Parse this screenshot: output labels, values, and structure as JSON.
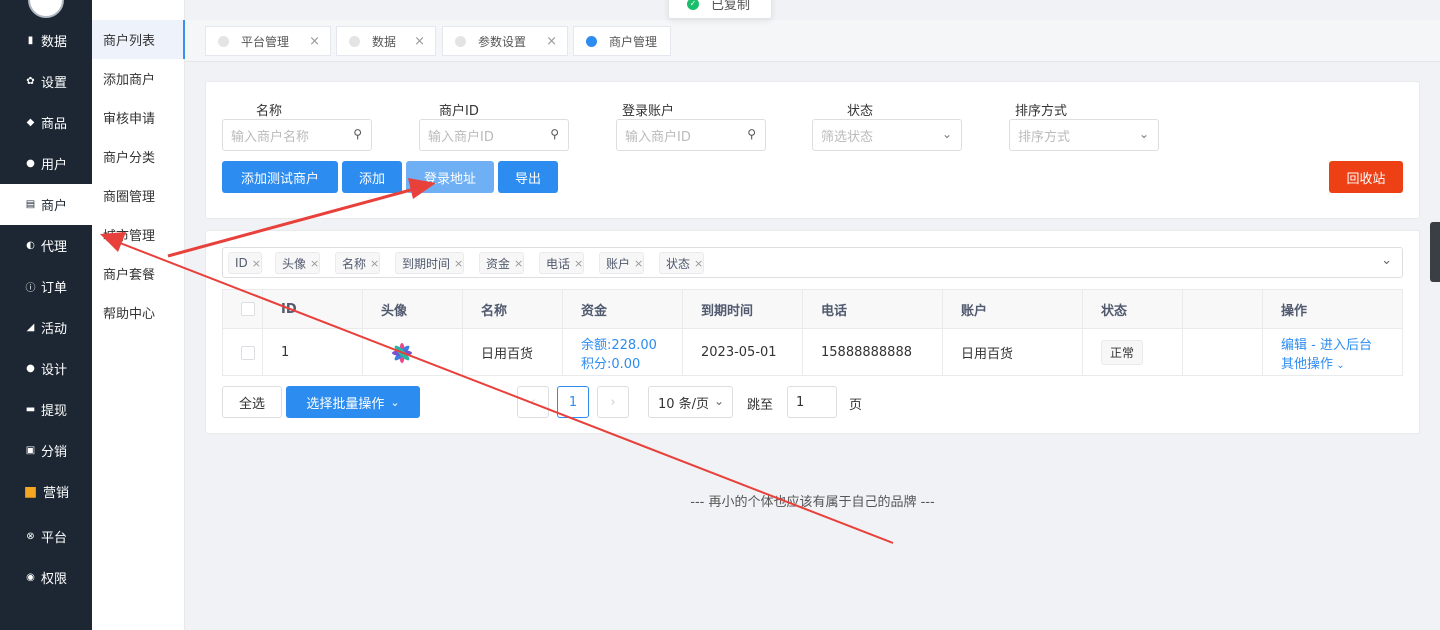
{
  "toast": {
    "text": "已复制"
  },
  "sidebar": {
    "items": [
      {
        "label": "数据",
        "icon": "bar-chart-icon",
        "glyph": "▮"
      },
      {
        "label": "设置",
        "icon": "gear-icon",
        "glyph": "✿"
      },
      {
        "label": "商品",
        "icon": "cube-icon",
        "glyph": "◆"
      },
      {
        "label": "用户",
        "icon": "user-icon",
        "glyph": "●"
      },
      {
        "label": "商户",
        "icon": "list-icon",
        "glyph": "▤"
      },
      {
        "label": "代理",
        "icon": "pie-icon",
        "glyph": "◐"
      },
      {
        "label": "订单",
        "icon": "info-icon",
        "glyph": "ⓘ"
      },
      {
        "label": "活动",
        "icon": "tag-icon",
        "glyph": "◢"
      },
      {
        "label": "设计",
        "icon": "palette-icon",
        "glyph": "●"
      },
      {
        "label": "提现",
        "icon": "card-icon",
        "glyph": "▬"
      },
      {
        "label": "分销",
        "icon": "share-icon",
        "glyph": "▣"
      },
      {
        "label": "营销",
        "icon": "gift-box-icon",
        "glyph": "■"
      },
      {
        "label": "平台",
        "icon": "xbox-icon",
        "glyph": "⊗"
      },
      {
        "label": "权限",
        "icon": "compass-icon",
        "glyph": "◉"
      }
    ]
  },
  "submenu": {
    "items": [
      "商户列表",
      "添加商户",
      "审核申请",
      "商户分类",
      "商圈管理",
      "城市管理",
      "商户套餐",
      "帮助中心"
    ]
  },
  "tabs": [
    {
      "label": "平台管理",
      "close": "×"
    },
    {
      "label": "数据",
      "close": "×"
    },
    {
      "label": "参数设置",
      "close": "×"
    },
    {
      "label": "商户管理",
      "close": ""
    }
  ],
  "filters": {
    "name": {
      "label": "名称",
      "placeholder": "输入商户名称"
    },
    "merchant_id": {
      "label": "商户ID",
      "placeholder": "输入商户ID"
    },
    "login_account": {
      "label": "登录账户",
      "placeholder": "输入商户ID"
    },
    "status": {
      "label": "状态",
      "placeholder": "筛选状态"
    },
    "sort": {
      "label": "排序方式",
      "placeholder": "排序方式"
    }
  },
  "buttons": {
    "add_test": "添加测试商户",
    "add": "添加",
    "login_url": "登录地址",
    "export": "导出",
    "recycle": "回收站",
    "select_all": "全选",
    "batch": "选择批量操作"
  },
  "column_tags": [
    "ID",
    "头像",
    "名称",
    "到期时间",
    "资金",
    "电话",
    "账户",
    "状态"
  ],
  "table": {
    "headers": [
      "ID",
      "头像",
      "名称",
      "资金",
      "到期时间",
      "电话",
      "账户",
      "状态",
      "",
      "操作"
    ],
    "rows": [
      {
        "id": "1",
        "name": "日用百货",
        "balance": "余额:228.00",
        "points": "积分:0.00",
        "expire": "2023-05-01",
        "phone": "15888888888",
        "account": "日用百货",
        "status": "正常",
        "edit": "编辑",
        "sep": " - ",
        "enter": "进入后台",
        "more": "其他操作"
      }
    ]
  },
  "pagination": {
    "current": "1",
    "page_size": "10 条/页",
    "jump_label": "跳至",
    "jump_value": "1",
    "page_unit": "页"
  },
  "footer": "--- 再小的个体也应该有属于自己的品牌 ---",
  "colors": {
    "primary": "#2d8cf0",
    "danger": "#ed4014",
    "sidebar": "#1d2733",
    "annotation": "#e8403a"
  }
}
